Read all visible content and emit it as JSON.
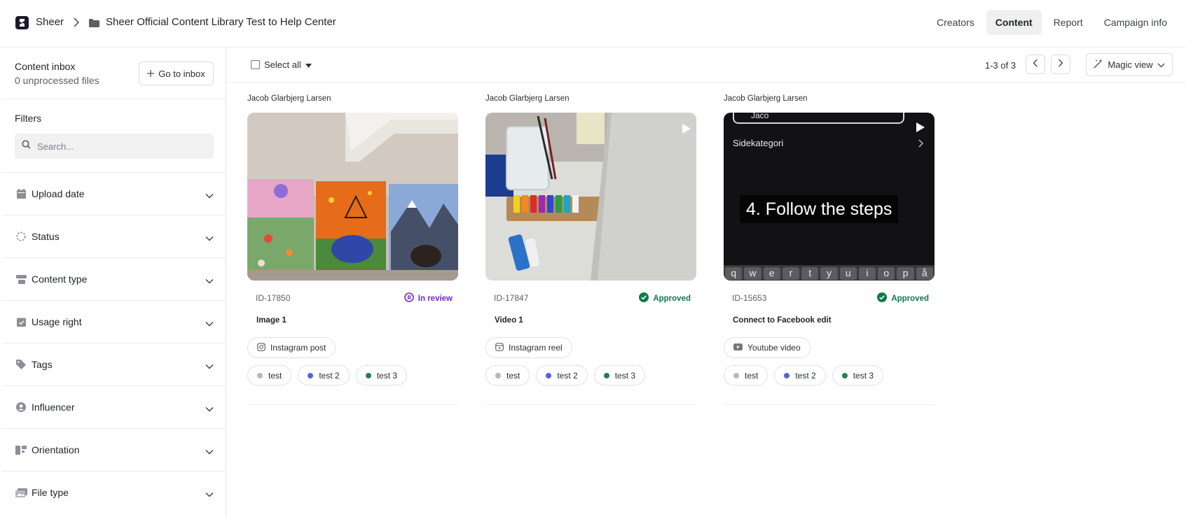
{
  "header": {
    "brand": "Sheer",
    "project": "Sheer Official Content Library Test to Help Center",
    "nav": [
      {
        "label": "Creators",
        "active": false
      },
      {
        "label": "Content",
        "active": true
      },
      {
        "label": "Report",
        "active": false
      },
      {
        "label": "Campaign info",
        "active": false
      }
    ]
  },
  "sidebar": {
    "inbox_title": "Content inbox",
    "inbox_sub": "0 unprocessed files",
    "inbox_button": "Go to inbox",
    "filters_title": "Filters",
    "search_placeholder": "Search...",
    "filters": [
      {
        "label": "Upload date",
        "icon": "calendar-icon"
      },
      {
        "label": "Status",
        "icon": "status-circle-icon"
      },
      {
        "label": "Content type",
        "icon": "content-type-icon"
      },
      {
        "label": "Usage right",
        "icon": "usage-right-icon"
      },
      {
        "label": "Tags",
        "icon": "tag-icon"
      },
      {
        "label": "Influencer",
        "icon": "user-icon"
      },
      {
        "label": "Orientation",
        "icon": "orientation-icon"
      },
      {
        "label": "File type",
        "icon": "file-type-icon"
      }
    ]
  },
  "toolbar": {
    "select_all": "Select all",
    "pager": "1-3 of 3",
    "magic_view": "Magic view"
  },
  "colors": {
    "review": "#6d28d9",
    "approved": "#0f7a4a",
    "tag_gray": "#b8b8b8",
    "tag_blue": "#5b63d3",
    "tag_green": "#2e7d4f"
  },
  "cards": [
    {
      "creator": "Jacob Glarbjerg Larsen",
      "id": "ID-17850",
      "status": "In review",
      "title": "Image 1",
      "type": "Instagram post",
      "type_icon": "instagram-icon",
      "tags": [
        "test",
        "test 2",
        "test 3"
      ]
    },
    {
      "creator": "Jacob Glarbjerg Larsen",
      "id": "ID-17847",
      "status": "Approved",
      "title": "Video 1",
      "type": "Instagram reel",
      "type_icon": "reel-icon",
      "tags": [
        "test",
        "test 2",
        "test 3"
      ]
    },
    {
      "creator": "Jacob Glarbjerg Larsen",
      "id": "ID-15653",
      "status": "Approved",
      "title": "Connect to Facebook edit",
      "type": "Youtube video",
      "type_icon": "youtube-icon",
      "tags": [
        "test",
        "test 2",
        "test 3"
      ],
      "thumb_text": {
        "search_value": "Jaco",
        "menu": "Sidekategori",
        "caption": "4. Follow the steps",
        "keys": [
          "q",
          "w",
          "e",
          "r",
          "t",
          "y",
          "u",
          "i",
          "o",
          "p",
          "å"
        ]
      }
    }
  ]
}
